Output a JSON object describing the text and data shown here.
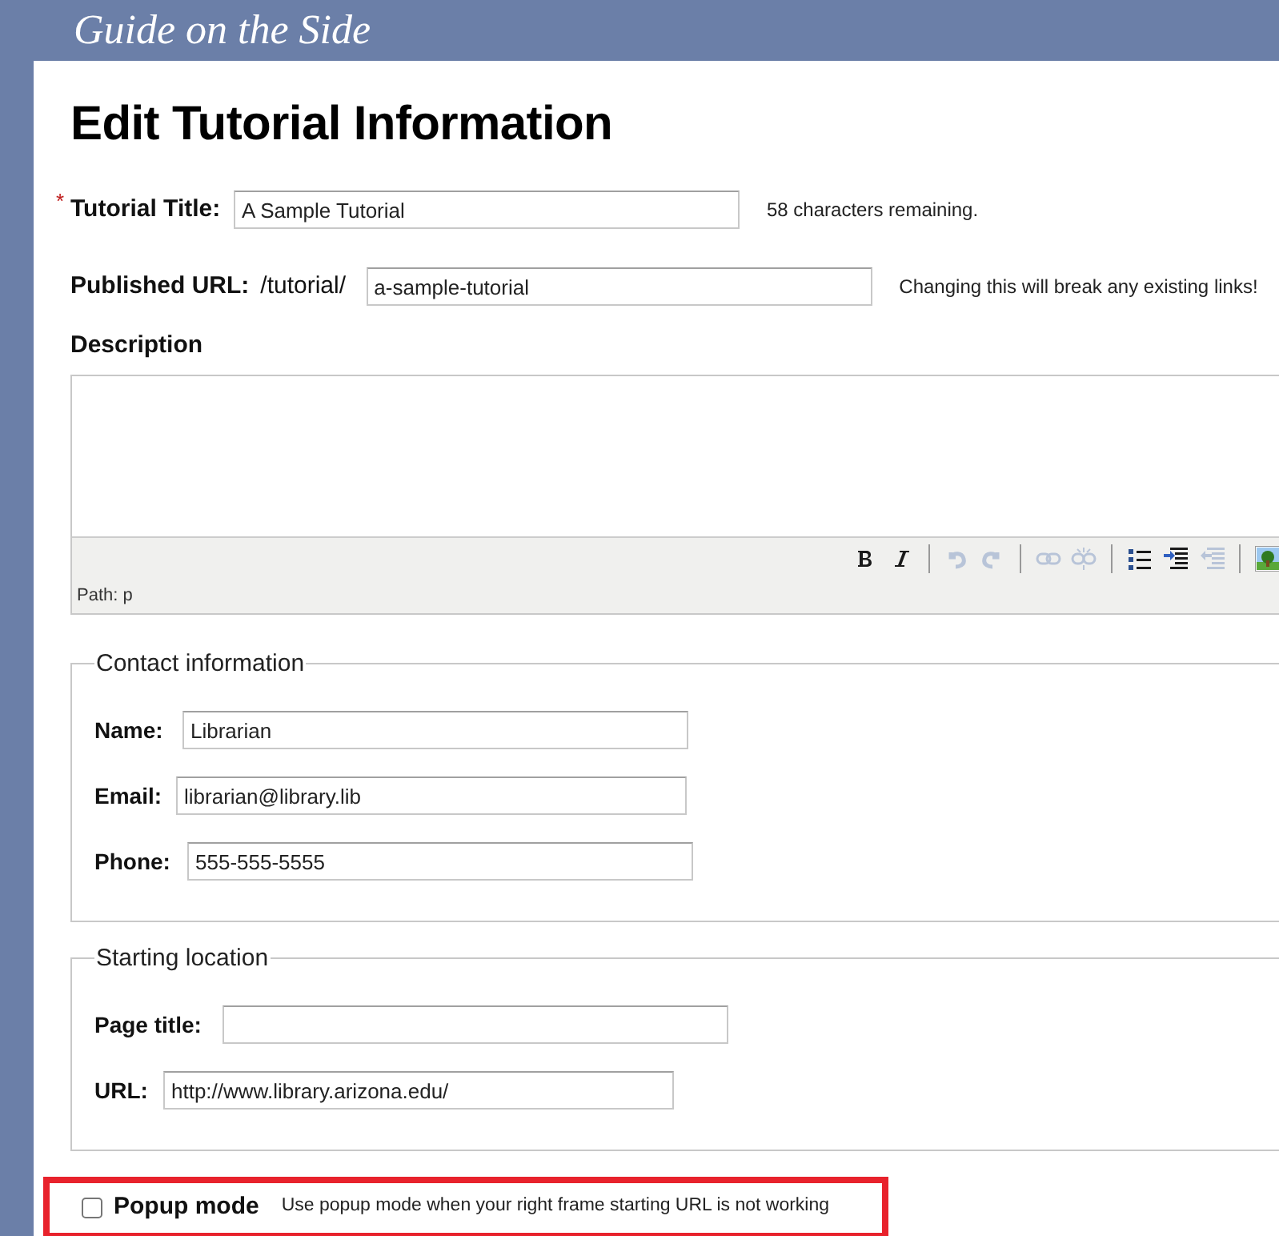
{
  "site_title": "Guide on the Side",
  "page_title": "Edit Tutorial Information",
  "tutorial_title": {
    "label": "Tutorial Title:",
    "required_mark": "*",
    "value": "A Sample Tutorial",
    "hint": "58 characters remaining."
  },
  "published_url": {
    "label": "Published URL:",
    "prefix": "/tutorial/",
    "value": "a-sample-tutorial",
    "hint": "Changing this will break any existing links!"
  },
  "description": {
    "label": "Description",
    "path": "Path: p",
    "toolbar_groups": [
      [
        {
          "kind": "bold",
          "disabled": false
        },
        {
          "kind": "italic",
          "disabled": false
        }
      ],
      [
        {
          "kind": "undo",
          "disabled": true
        },
        {
          "kind": "redo",
          "disabled": true
        }
      ],
      [
        {
          "kind": "link",
          "disabled": true
        },
        {
          "kind": "unlink",
          "disabled": true
        }
      ],
      [
        {
          "kind": "bullets",
          "disabled": false
        },
        {
          "kind": "indent",
          "disabled": false
        },
        {
          "kind": "outdent",
          "disabled": true
        }
      ],
      [
        {
          "kind": "image",
          "disabled": false
        }
      ]
    ]
  },
  "fieldsets": [
    {
      "legend": "Contact information",
      "fields": [
        {
          "label": "Name:",
          "value": "Librarian"
        },
        {
          "label": "Email:",
          "value": "librarian@library.lib"
        },
        {
          "label": "Phone:",
          "value": "555-555-5555"
        }
      ]
    },
    {
      "legend": "Starting location",
      "fields": [
        {
          "label": "Page title:"
        },
        {
          "label": "URL:",
          "value": "http://www.library.arizona.edu/"
        }
      ]
    }
  ],
  "popup": {
    "label": "Popup mode",
    "checked": false,
    "hint": "Use popup mode when your right frame starting URL is not working",
    "highlighted": true
  }
}
